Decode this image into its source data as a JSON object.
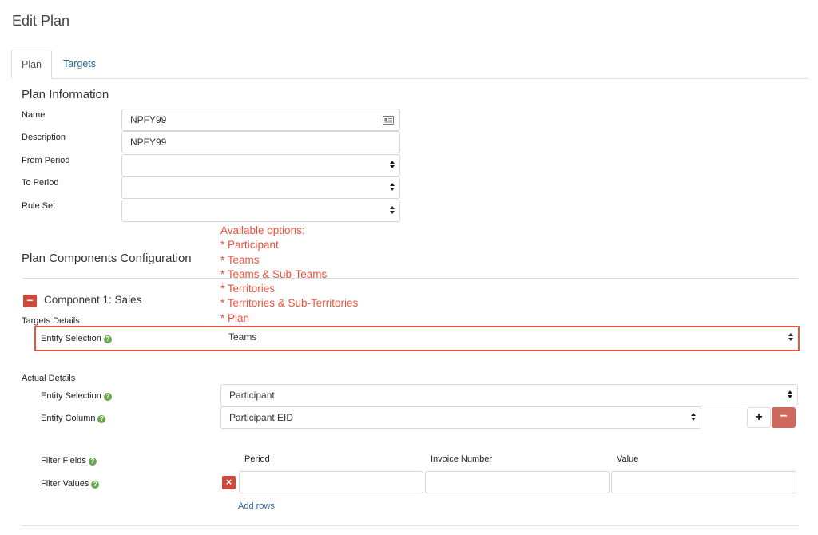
{
  "page_title": "Edit Plan",
  "tabs": [
    {
      "label": "Plan",
      "active": true
    },
    {
      "label": "Targets",
      "active": false
    }
  ],
  "plan_info": {
    "title": "Plan Information",
    "name_label": "Name",
    "name_value": "NPFY99",
    "description_label": "Description",
    "description_value": "NPFY99",
    "from_period_label": "From Period",
    "from_period_value": "",
    "to_period_label": "To Period",
    "to_period_value": "",
    "rule_set_label": "Rule Set",
    "rule_set_value": ""
  },
  "components_config": {
    "title": "Plan Components Configuration",
    "annotation": {
      "heading": "Available options:",
      "options": [
        "* Participant",
        "* Teams",
        "* Teams & Sub-Teams",
        "* Territories",
        "* Territories & Sub-Territories",
        "* Plan"
      ]
    }
  },
  "component1": {
    "title": "Component 1: Sales",
    "collapse_symbol": "−",
    "targets_details_label": "Targets Details",
    "targets_entity_label": "Entity Selection",
    "targets_entity_value": "Teams",
    "actual_details_label": "Actual Details",
    "actual_entity_label": "Entity Selection",
    "actual_entity_value": "Participant",
    "entity_column_label": "Entity Column",
    "entity_column_value": "Participant EID",
    "add_symbol": "+",
    "remove_symbol": "−",
    "filter_fields_label": "Filter Fields",
    "filter_values_label": "Filter Values",
    "filter_columns": [
      "Period",
      "Invoice Number",
      "Value"
    ],
    "filter_values": [
      "",
      "",
      ""
    ],
    "delete_symbol": "×",
    "add_rows_label": "Add rows"
  },
  "colors": {
    "link": "#2a6496",
    "annotation": "#e8533d",
    "danger": "#cd4a3a",
    "help": "#6aa84f"
  },
  "icons": {
    "name_field": "contact-card-icon",
    "help": "question-circle-icon"
  }
}
